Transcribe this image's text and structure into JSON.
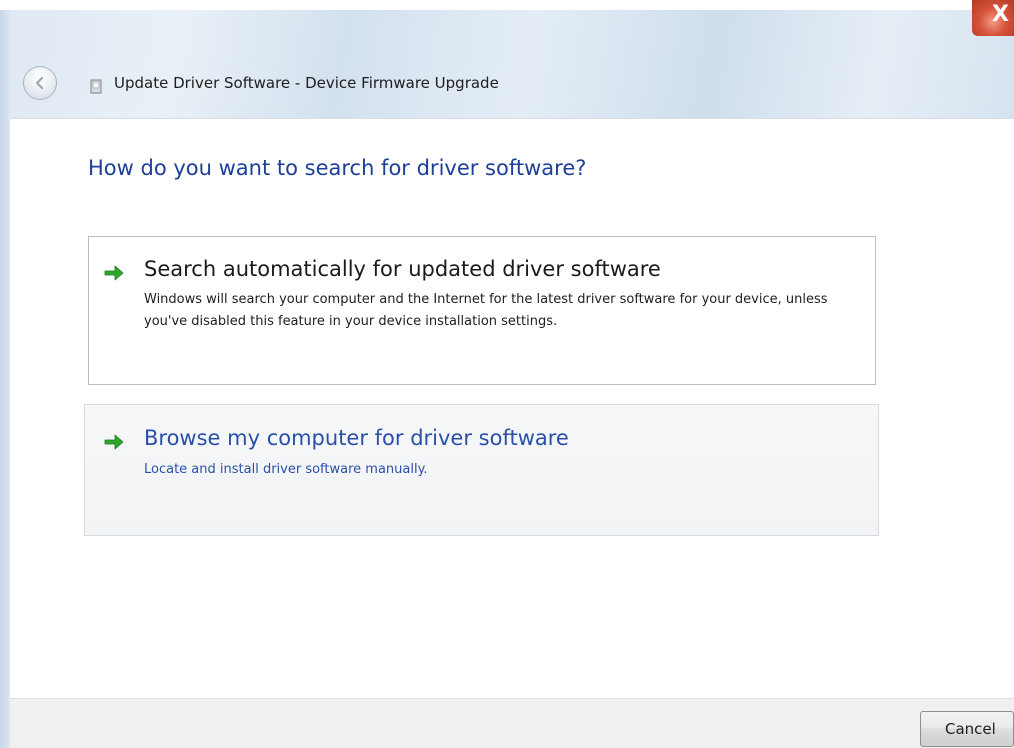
{
  "window": {
    "title": "Update Driver Software - Device Firmware Upgrade",
    "close_label": "X"
  },
  "heading": "How do you want to search for driver software?",
  "options": [
    {
      "title": "Search automatically for updated driver software",
      "description": "Windows will search your computer and the Internet for the latest driver software for your device, unless you've disabled this feature in your device installation settings.",
      "icon": "green-arrow-icon"
    },
    {
      "title": "Browse my computer for driver software",
      "description": "Locate and install driver software manually.",
      "icon": "green-arrow-icon"
    }
  ],
  "footer": {
    "cancel_label": "Cancel"
  },
  "colors": {
    "heading": "#1e3f99",
    "link_blue": "#2b4fa8",
    "arrow_green": "#2fa52a",
    "close_red": "#c8432c"
  }
}
